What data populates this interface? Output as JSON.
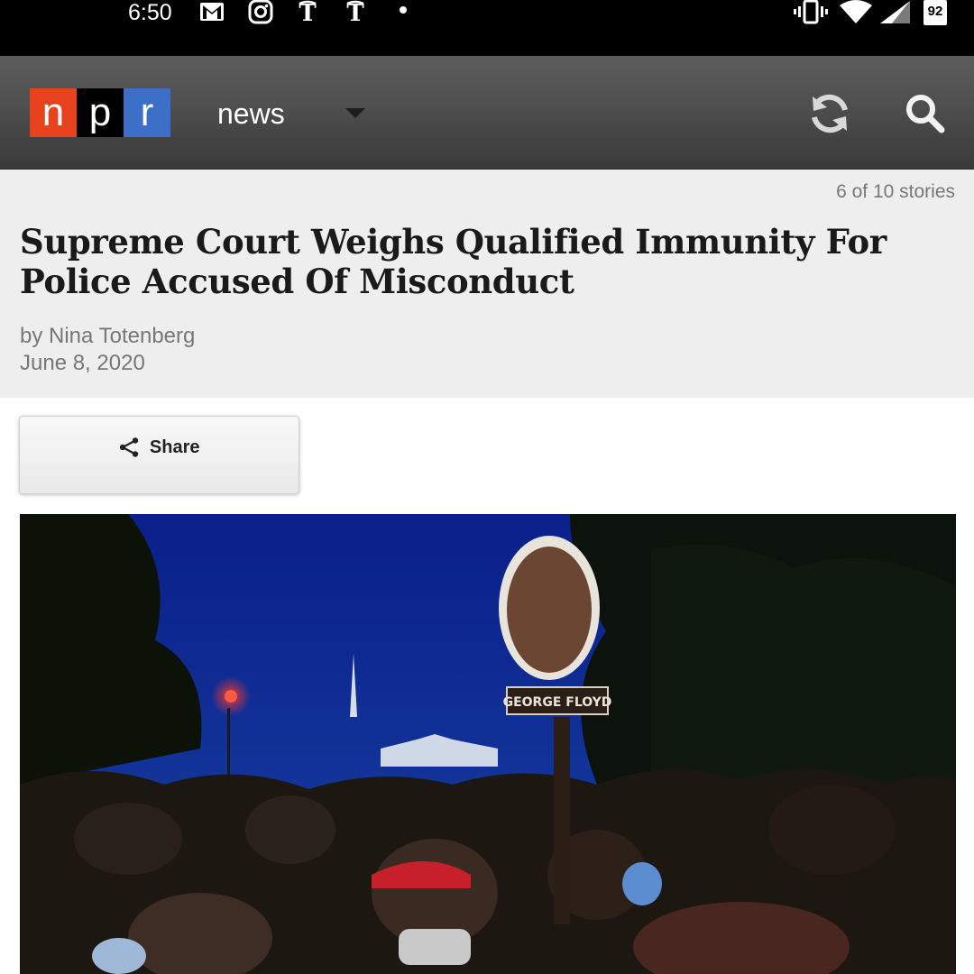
{
  "status_bar": {
    "time": "6:50",
    "battery": "92",
    "icons": [
      "gmail-icon",
      "instagram-icon",
      "nyt-icon",
      "nyt-icon",
      "notification-dot-icon",
      "vibrate-icon",
      "wifi-icon",
      "cell-signal-icon",
      "battery-icon"
    ]
  },
  "app_bar": {
    "logo": {
      "letters": [
        "n",
        "p",
        "r"
      ],
      "colors": [
        "#e8411e",
        "#000000",
        "#3c6fc8"
      ]
    },
    "section": "news",
    "icons": [
      "dropdown-caret-icon",
      "refresh-icon",
      "search-icon"
    ]
  },
  "article": {
    "story_count": "6 of 10 stories",
    "headline": "Supreme Court Weighs Qualified Immunity For Police Accused Of Misconduct",
    "byline": "by Nina Totenberg",
    "date": "June 8, 2020",
    "share_label": "Share",
    "photo_sign_text": "GEORGE FLOYD"
  },
  "colors": {
    "app_bar": "#4e4e4e",
    "header_bg": "#eeeeee",
    "meta_text": "#777777"
  }
}
